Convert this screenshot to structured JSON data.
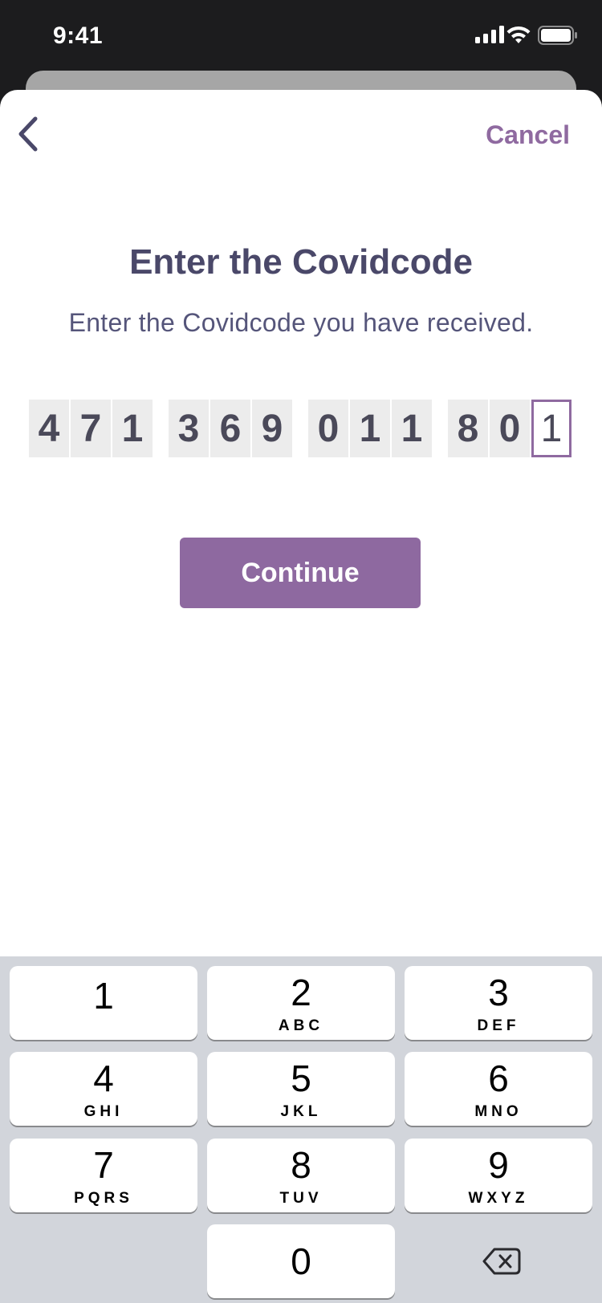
{
  "status_bar": {
    "time": "9:41"
  },
  "header": {
    "back_icon": "chevron-left-icon",
    "cancel_label": "Cancel"
  },
  "main": {
    "title": "Enter the Covidcode",
    "subtitle": "Enter the Covidcode you have received."
  },
  "code": {
    "digits": [
      "4",
      "7",
      "1",
      "3",
      "6",
      "9",
      "0",
      "1",
      "1",
      "8",
      "0",
      "1"
    ],
    "active_index": 11
  },
  "continue_label": "Continue",
  "keypad": {
    "keys": [
      {
        "num": "1",
        "letters": ""
      },
      {
        "num": "2",
        "letters": "ABC"
      },
      {
        "num": "3",
        "letters": "DEF"
      },
      {
        "num": "4",
        "letters": "GHI"
      },
      {
        "num": "5",
        "letters": "JKL"
      },
      {
        "num": "6",
        "letters": "MNO"
      },
      {
        "num": "7",
        "letters": "PQRS"
      },
      {
        "num": "8",
        "letters": "TUV"
      },
      {
        "num": "9",
        "letters": "WXYZ"
      },
      {
        "num": "0",
        "letters": ""
      }
    ],
    "backspace_icon": "backspace-icon"
  },
  "colors": {
    "accent": "#8f6aa0",
    "text": "#4a4869"
  }
}
